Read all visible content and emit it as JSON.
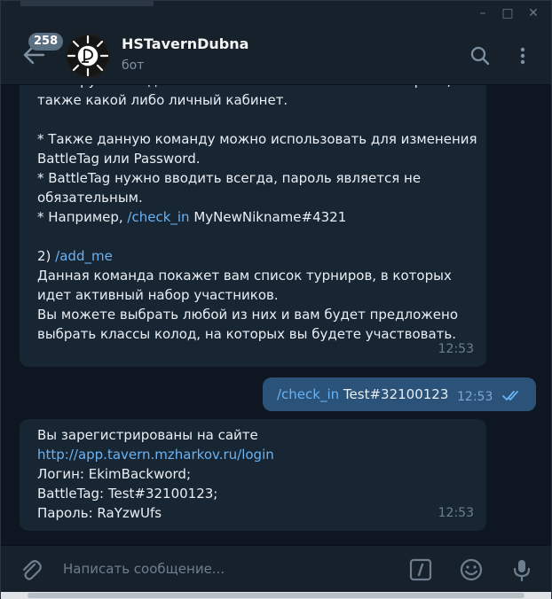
{
  "header": {
    "badge": "258",
    "title": "HSTavernDubna",
    "subtitle": "бот"
  },
  "icons": {
    "back": "arrow-left-icon",
    "search": "search-icon",
    "menu": "more-vertical-icon",
    "attach": "paperclip-icon",
    "commands": "slash-command-icon",
    "emoji": "emoji-icon",
    "mic": "microphone-icon"
  },
  "messages": {
    "m1": {
      "lines": [
        {
          "text": "планируется ведение и отслеживание статистики игрока, а"
        },
        {
          "text": "также какой либо личный кабинет."
        },
        {
          "text": ""
        },
        {
          "text": "* Также данную команду можно использовать для изменения"
        },
        {
          "text": "BattleTag или Password."
        },
        {
          "text": "* BattleTag нужно вводить всегда, пароль является не"
        },
        {
          "text": "обязательным."
        },
        {
          "pre": "* Например, ",
          "link": "/check_in",
          "post": " MyNewNikname#4321"
        },
        {
          "text": ""
        },
        {
          "pre": "2) ",
          "link": "/add_me",
          "post": ""
        },
        {
          "text": "Данная команда покажет вам список турниров, в которых"
        },
        {
          "text": "идет активный набор участников."
        },
        {
          "text": "Вы можете выбрать любой из них и вам будет предложено"
        },
        {
          "text": "выбрать классы колод, на которых вы будете участвовать."
        }
      ],
      "time": "12:53"
    },
    "m2": {
      "link": "/check_in",
      "post": " Test#32100123",
      "time": "12:53"
    },
    "m3": {
      "lines": [
        {
          "text": "Вы зарегистрированы на сайте"
        },
        {
          "pre": "",
          "link": "http://app.tavern.mzharkov.ru/login",
          "post": ""
        },
        {
          "text": "Логин: EkimBackword;"
        },
        {
          "text": "BattleTag: Test#32100123;"
        },
        {
          "text": "Пароль: RaYzwUfs"
        }
      ],
      "time": "12:53"
    }
  },
  "composer": {
    "placeholder": "Написать сообщение..."
  },
  "colors": {
    "background": "#0e1621",
    "panel": "#17212b",
    "incoming": "#182533",
    "outgoing": "#2b5278",
    "link": "#6ab3f3"
  }
}
